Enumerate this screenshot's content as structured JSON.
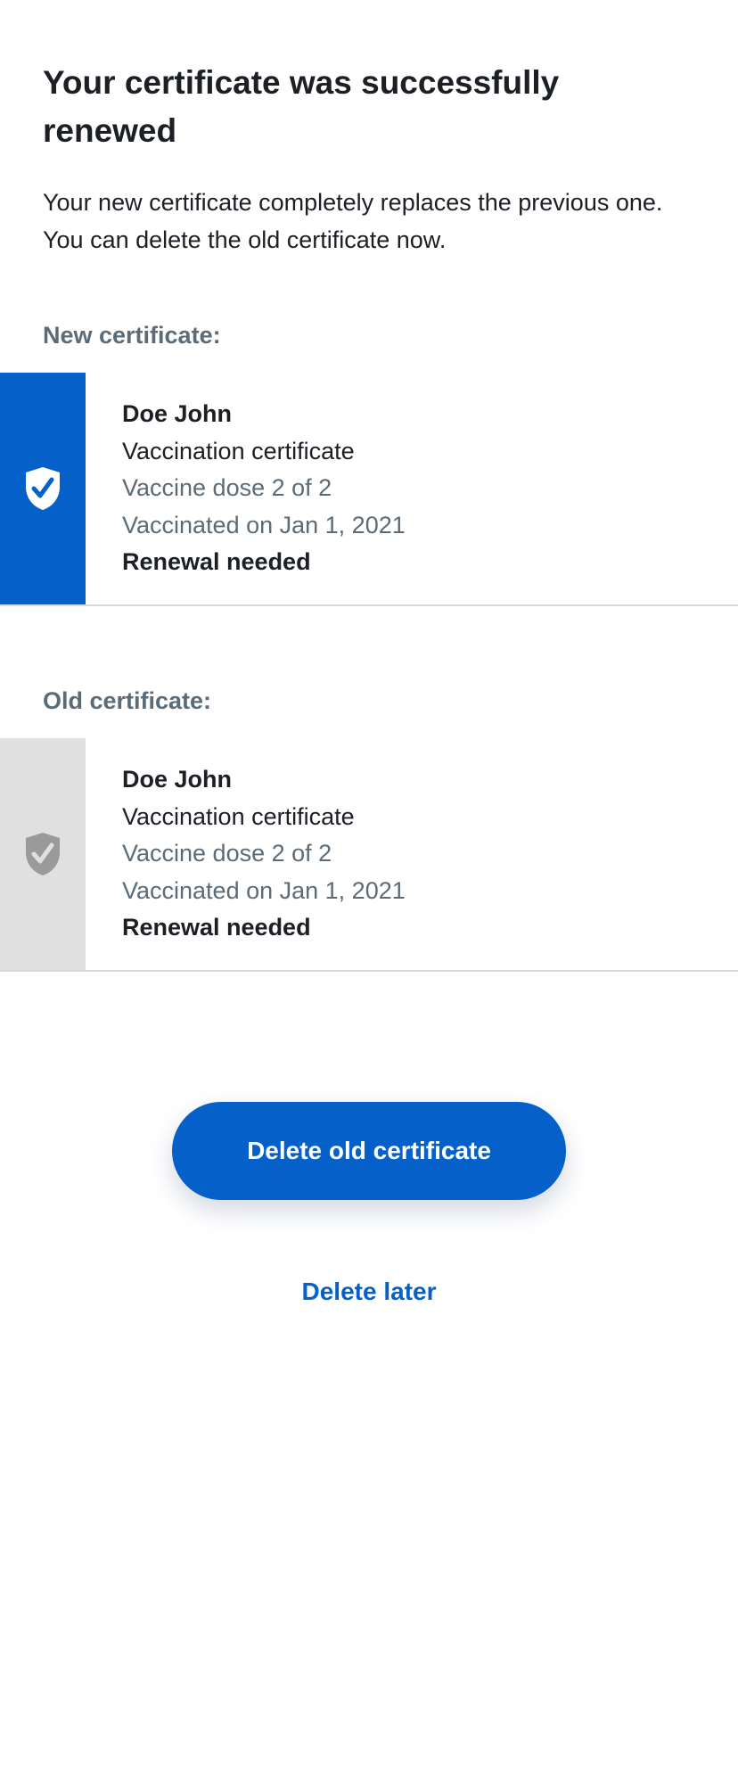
{
  "header": {
    "title": "Your certificate was successfully renewed",
    "description": "Your new certificate completely replaces the previous one. You can delete the old certificate now."
  },
  "new_certificate": {
    "section_label": "New certificate:",
    "icon": "shield-check-icon",
    "accent_color": "#0560c9",
    "name": "Doe John",
    "type": "Vaccination certificate",
    "dose": "Vaccine dose 2 of 2",
    "date": "Vaccinated on Jan 1, 2021",
    "status": "Renewal needed"
  },
  "old_certificate": {
    "section_label": "Old certificate:",
    "icon": "shield-check-icon",
    "accent_color": "#e0e0e0",
    "name": "Doe John",
    "type": "Vaccination certificate",
    "dose": "Vaccine dose 2 of 2",
    "date": "Vaccinated on Jan 1, 2021",
    "status": "Renewal needed"
  },
  "actions": {
    "delete_label": "Delete old certificate",
    "later_label": "Delete later"
  },
  "colors": {
    "primary": "#0560c9",
    "text": "#1c1f24",
    "muted": "#5b6b78"
  }
}
